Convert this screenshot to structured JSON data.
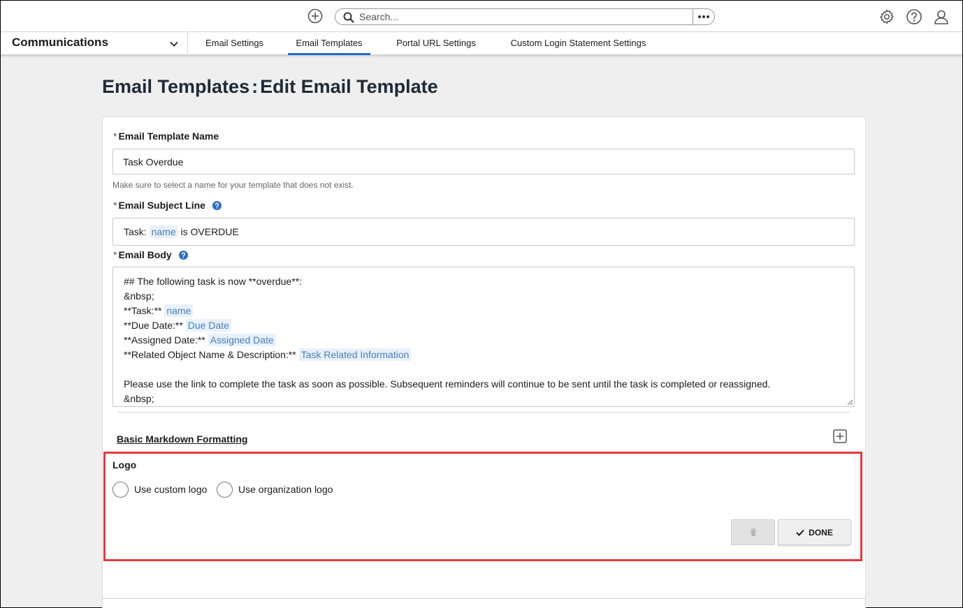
{
  "topbar": {
    "add_icon": "plus-circle-icon",
    "search": {
      "placeholder": "Search...",
      "value": ""
    },
    "more_icon": "ellipsis-icon",
    "icons": [
      "gear-icon",
      "help-circle-icon",
      "user-icon"
    ]
  },
  "nav": {
    "app_name": "Communications",
    "tabs": [
      {
        "label": "Email Settings",
        "active": false
      },
      {
        "label": "Email Templates",
        "active": true
      },
      {
        "label": "Portal URL Settings",
        "active": false
      },
      {
        "label": "Custom Login Statement Settings",
        "active": false
      }
    ]
  },
  "page": {
    "title_prefix": "Email Templates",
    "title_separator": ":",
    "title_suffix": "Edit Email Template"
  },
  "form": {
    "required_marker": "*",
    "template_name": {
      "label": "Email Template Name",
      "value": "Task Overdue",
      "helper": "Make sure to select a name for your template that does not exist."
    },
    "subject": {
      "label": "Email Subject Line",
      "prefix": "Task:",
      "token": "name",
      "suffix": "is OVERDUE"
    },
    "body": {
      "label": "Email Body",
      "line1": "## The following task is now **overdue**:",
      "line2": "&nbsp;",
      "line3_text": "**Task:**",
      "line3_token": "name",
      "line4_text": "**Due Date:**",
      "line4_token": "Due Date",
      "line5_text": "**Assigned Date:**",
      "line5_token": "Assigned Date",
      "line6_text": "**Related Object Name & Description:**",
      "line6_token": "Task Related Information",
      "line8": "Please use the link to complete the task as soon as possible. Subsequent reminders will continue to be sent until the task is completed or reassigned.",
      "line9": "&nbsp;"
    },
    "markdown_link": "Basic Markdown Formatting",
    "logo": {
      "label": "Logo",
      "options": [
        {
          "label": "Use custom logo",
          "selected": false
        },
        {
          "label": "Use organization logo",
          "selected": false
        }
      ]
    },
    "done_label": "DONE"
  },
  "colors": {
    "accent": "#1f6cc7",
    "highlight_border": "#e4393f",
    "token_bg": "#e8f1fb",
    "token_text": "#4b7fb8"
  }
}
